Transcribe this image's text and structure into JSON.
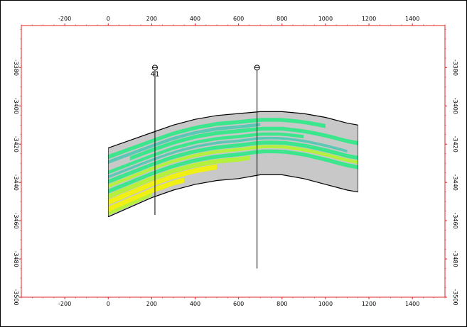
{
  "chart_data": {
    "type": "area",
    "title": "",
    "xlabel": "",
    "ylabel": "",
    "xlim": [
      -400,
      1550
    ],
    "ylim": [
      -3500,
      -3358
    ],
    "x_ticks": [
      -200,
      0,
      200,
      400,
      600,
      800,
      1000,
      1200,
      1400
    ],
    "y_ticks": [
      -3380,
      -3400,
      -3420,
      -3440,
      -3460,
      -3480,
      -3500
    ],
    "x_tick_labels": [
      "-200",
      "0",
      "200",
      "400",
      "600",
      "800",
      "1000",
      "1200",
      "1400"
    ],
    "y_tick_labels": [
      "-3380",
      "-3400",
      "-3420",
      "-3440",
      "-3460",
      "-3480",
      "-3500"
    ],
    "right_y_tick_labels": [
      "-3380",
      "-3400",
      "-3420",
      "-3440",
      "-3460",
      "-3480",
      "-3500"
    ],
    "grid": false,
    "frame_color": "#e02020",
    "facies_colors": {
      "background": "#c8c8c8",
      "green": "#3ce68c",
      "teal": "#5ac8b4",
      "lime": "#b4f03c",
      "yellow": "#f0f014"
    },
    "body": {
      "top": [
        [
          0,
          -3422
        ],
        [
          100,
          -3418
        ],
        [
          200,
          -3414
        ],
        [
          300,
          -3410
        ],
        [
          400,
          -3407
        ],
        [
          500,
          -3405
        ],
        [
          600,
          -3404
        ],
        [
          700,
          -3403
        ],
        [
          800,
          -3403
        ],
        [
          900,
          -3404
        ],
        [
          1000,
          -3406
        ],
        [
          1100,
          -3409
        ],
        [
          1150,
          -3410
        ]
      ],
      "bottom": [
        [
          0,
          -3458
        ],
        [
          100,
          -3453
        ],
        [
          200,
          -3448
        ],
        [
          300,
          -3444
        ],
        [
          400,
          -3441
        ],
        [
          500,
          -3439
        ],
        [
          600,
          -3438
        ],
        [
          700,
          -3436
        ],
        [
          800,
          -3436
        ],
        [
          900,
          -3438
        ],
        [
          1000,
          -3441
        ],
        [
          1100,
          -3444
        ],
        [
          1150,
          -3445
        ]
      ]
    },
    "bands": [
      {
        "color": "green",
        "from": 0.1,
        "to": 0.16,
        "x0": 0,
        "x1": 1000
      },
      {
        "color": "teal",
        "from": 0.18,
        "to": 0.23,
        "x0": 0,
        "x1": 700
      },
      {
        "color": "green",
        "from": 0.24,
        "to": 0.3,
        "x0": 100,
        "x1": 1150
      },
      {
        "color": "green",
        "from": 0.33,
        "to": 0.38,
        "x0": 0,
        "x1": 900
      },
      {
        "color": "teal",
        "from": 0.4,
        "to": 0.44,
        "x0": 0,
        "x1": 1100
      },
      {
        "color": "green",
        "from": 0.46,
        "to": 0.52,
        "x0": 0,
        "x1": 1150
      },
      {
        "color": "lime",
        "from": 0.53,
        "to": 0.58,
        "x0": 0,
        "x1": 1150
      },
      {
        "color": "green",
        "from": 0.6,
        "to": 0.66,
        "x0": 0,
        "x1": 1150
      },
      {
        "color": "lime",
        "from": 0.67,
        "to": 0.74,
        "x0": 0,
        "x1": 650
      },
      {
        "color": "yellow",
        "from": 0.75,
        "to": 0.83,
        "x0": 0,
        "x1": 500
      },
      {
        "color": "yellow",
        "from": 0.85,
        "to": 0.93,
        "x0": 0,
        "x1": 350
      },
      {
        "color": "lime",
        "from": 0.93,
        "to": 0.98,
        "x0": 0,
        "x1": 200
      }
    ],
    "wells": [
      {
        "name": "41",
        "x": 215,
        "y_top": -3380,
        "y_bottom": -3457
      },
      {
        "name": "",
        "x": 685,
        "y_top": -3380,
        "y_bottom": -3485
      }
    ]
  }
}
